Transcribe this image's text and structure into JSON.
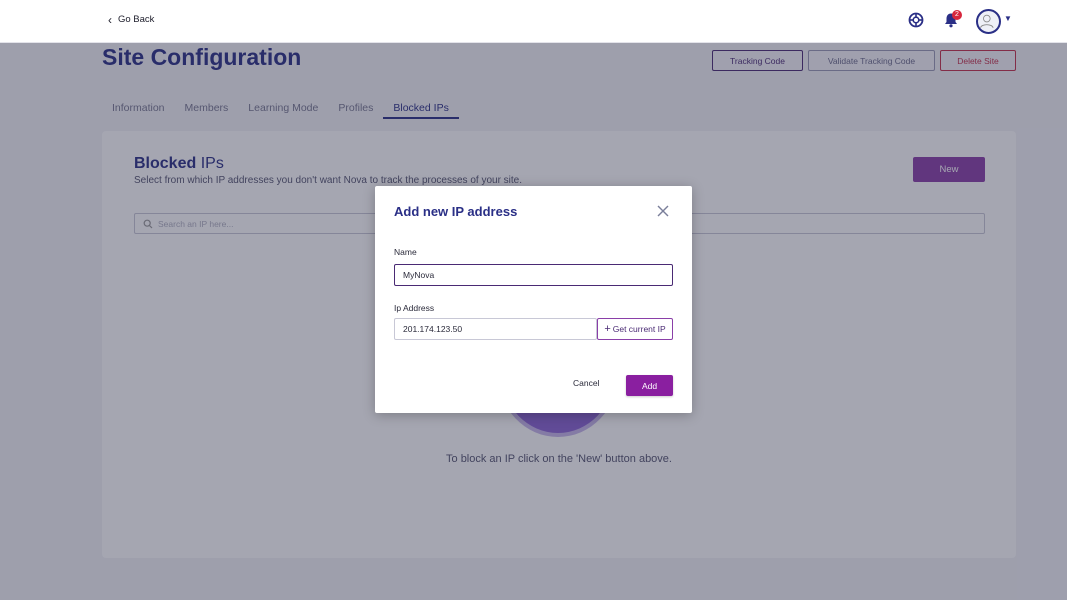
{
  "topbar": {
    "go_back": "Go Back",
    "notifications_count": "2",
    "icons": [
      "chevron-left-icon",
      "help-lifebuoy-icon",
      "bell-icon",
      "avatar",
      "caret-down-icon"
    ]
  },
  "header": {
    "title": "Site Configuration",
    "buttons": {
      "tracking_code": "Tracking Code",
      "validate_tracking_code": "Validate Tracking Code",
      "delete_site": "Delete Site"
    }
  },
  "tabs": [
    {
      "label": "Information",
      "active": false
    },
    {
      "label": "Members",
      "active": false
    },
    {
      "label": "Learning Mode",
      "active": false
    },
    {
      "label": "Profiles",
      "active": false
    },
    {
      "label": "Blocked IPs",
      "active": true
    }
  ],
  "blocked_ips": {
    "title_bold": "Blocked",
    "title_rest": " IPs",
    "subtitle": "Select from which IP addresses you don't want Nova to track the processes of your site.",
    "new_button": "New",
    "search_placeholder": "Search an IP here...",
    "empty_message": "To block an IP click on the 'New' button above."
  },
  "modal": {
    "title": "Add new IP address",
    "name_label": "Name",
    "name_value": "MyNova",
    "ip_label": "Ip Address",
    "ip_value": "201.174.123.50",
    "get_ip_label": "Get current IP",
    "cancel_label": "Cancel",
    "add_label": "Add"
  },
  "colors": {
    "brand_navy": "#2a2f86",
    "brand_purple": "#8a1fa0",
    "danger": "#c4304a"
  }
}
